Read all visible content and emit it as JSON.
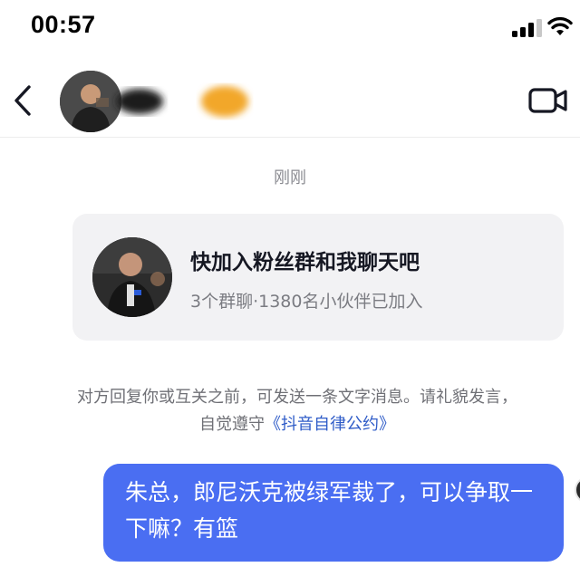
{
  "status_bar": {
    "time": "00:57"
  },
  "header": {
    "back_icon": "chevron-left-icon",
    "video_icon": "video-camera-icon"
  },
  "chat": {
    "timestamp": "刚刚",
    "group_card": {
      "title": "快加入粉丝群和我聊天吧",
      "subtitle": "3个群聊·1380名小伙伴已加入"
    },
    "notice": {
      "text_before_link": "对方回复你或互关之前，可发送一条文字消息。请礼貌发言，自觉遵守",
      "link_text": "《抖音自律公约》"
    },
    "my_message": {
      "text": "朱总，郎尼沃克被绿军裁了，可以争取一下嘛？有篮"
    }
  },
  "colors": {
    "bubble": "#4a6ef2",
    "link": "#2f5cc8",
    "card_bg": "#f2f2f4"
  }
}
